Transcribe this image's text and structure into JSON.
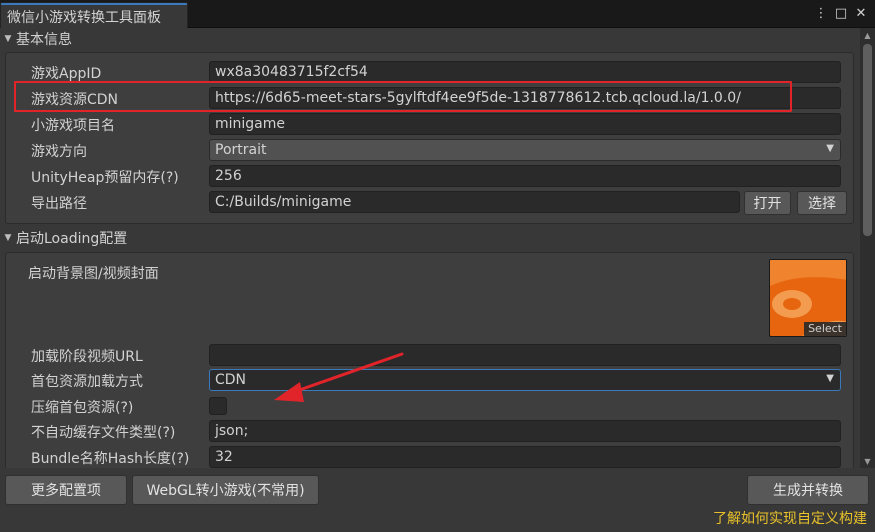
{
  "window": {
    "tab_title": "微信小游戏转换工具面板",
    "menu_icon": "kebab-menu-icon",
    "maximize_icon": "maximize-icon",
    "close_icon": "close-icon"
  },
  "sections": {
    "basic": {
      "title": "基本信息",
      "fields": {
        "appid": {
          "label": "游戏AppID",
          "value": "wx8a30483715f2cf54"
        },
        "cdn": {
          "label": "游戏资源CDN",
          "value": "https://6d65-meet-stars-5gylftdf4ee9f5de-1318778612.tcb.qcloud.la/1.0.0/"
        },
        "project_name": {
          "label": "小游戏项目名",
          "value": "minigame"
        },
        "orientation": {
          "label": "游戏方向",
          "value": "Portrait"
        },
        "unity_heap": {
          "label": "UnityHeap预留内存(?)",
          "value": "256"
        },
        "export_path": {
          "label": "导出路径",
          "value": "C:/Builds/minigame",
          "open_button": "打开",
          "select_button": "选择"
        }
      }
    },
    "loading": {
      "title": "启动Loading配置",
      "fields": {
        "cover": {
          "label": "启动背景图/视频封面",
          "select_label": "Select"
        },
        "video_url": {
          "label": "加载阶段视频URL",
          "value": ""
        },
        "first_pkg_mode": {
          "label": "首包资源加载方式",
          "value": "CDN"
        },
        "compress_first_pkg": {
          "label": "压缩首包资源(?)",
          "checked": false
        },
        "no_cache_types": {
          "label": "不自动缓存文件类型(?)",
          "value": "json;"
        },
        "bundle_hash_len": {
          "label": "Bundle名称Hash长度(?)",
          "value": "32"
        }
      }
    }
  },
  "footer": {
    "more_config": "更多配置项",
    "webgl_convert": "WebGL转小游戏(不常用)",
    "build_convert": "生成并转换",
    "help_link": "了解如何实现自定义构建"
  },
  "colors": {
    "annotation_red": "#e0242a",
    "link_yellow": "#e9c22a",
    "focus_blue": "#3a79bb"
  }
}
